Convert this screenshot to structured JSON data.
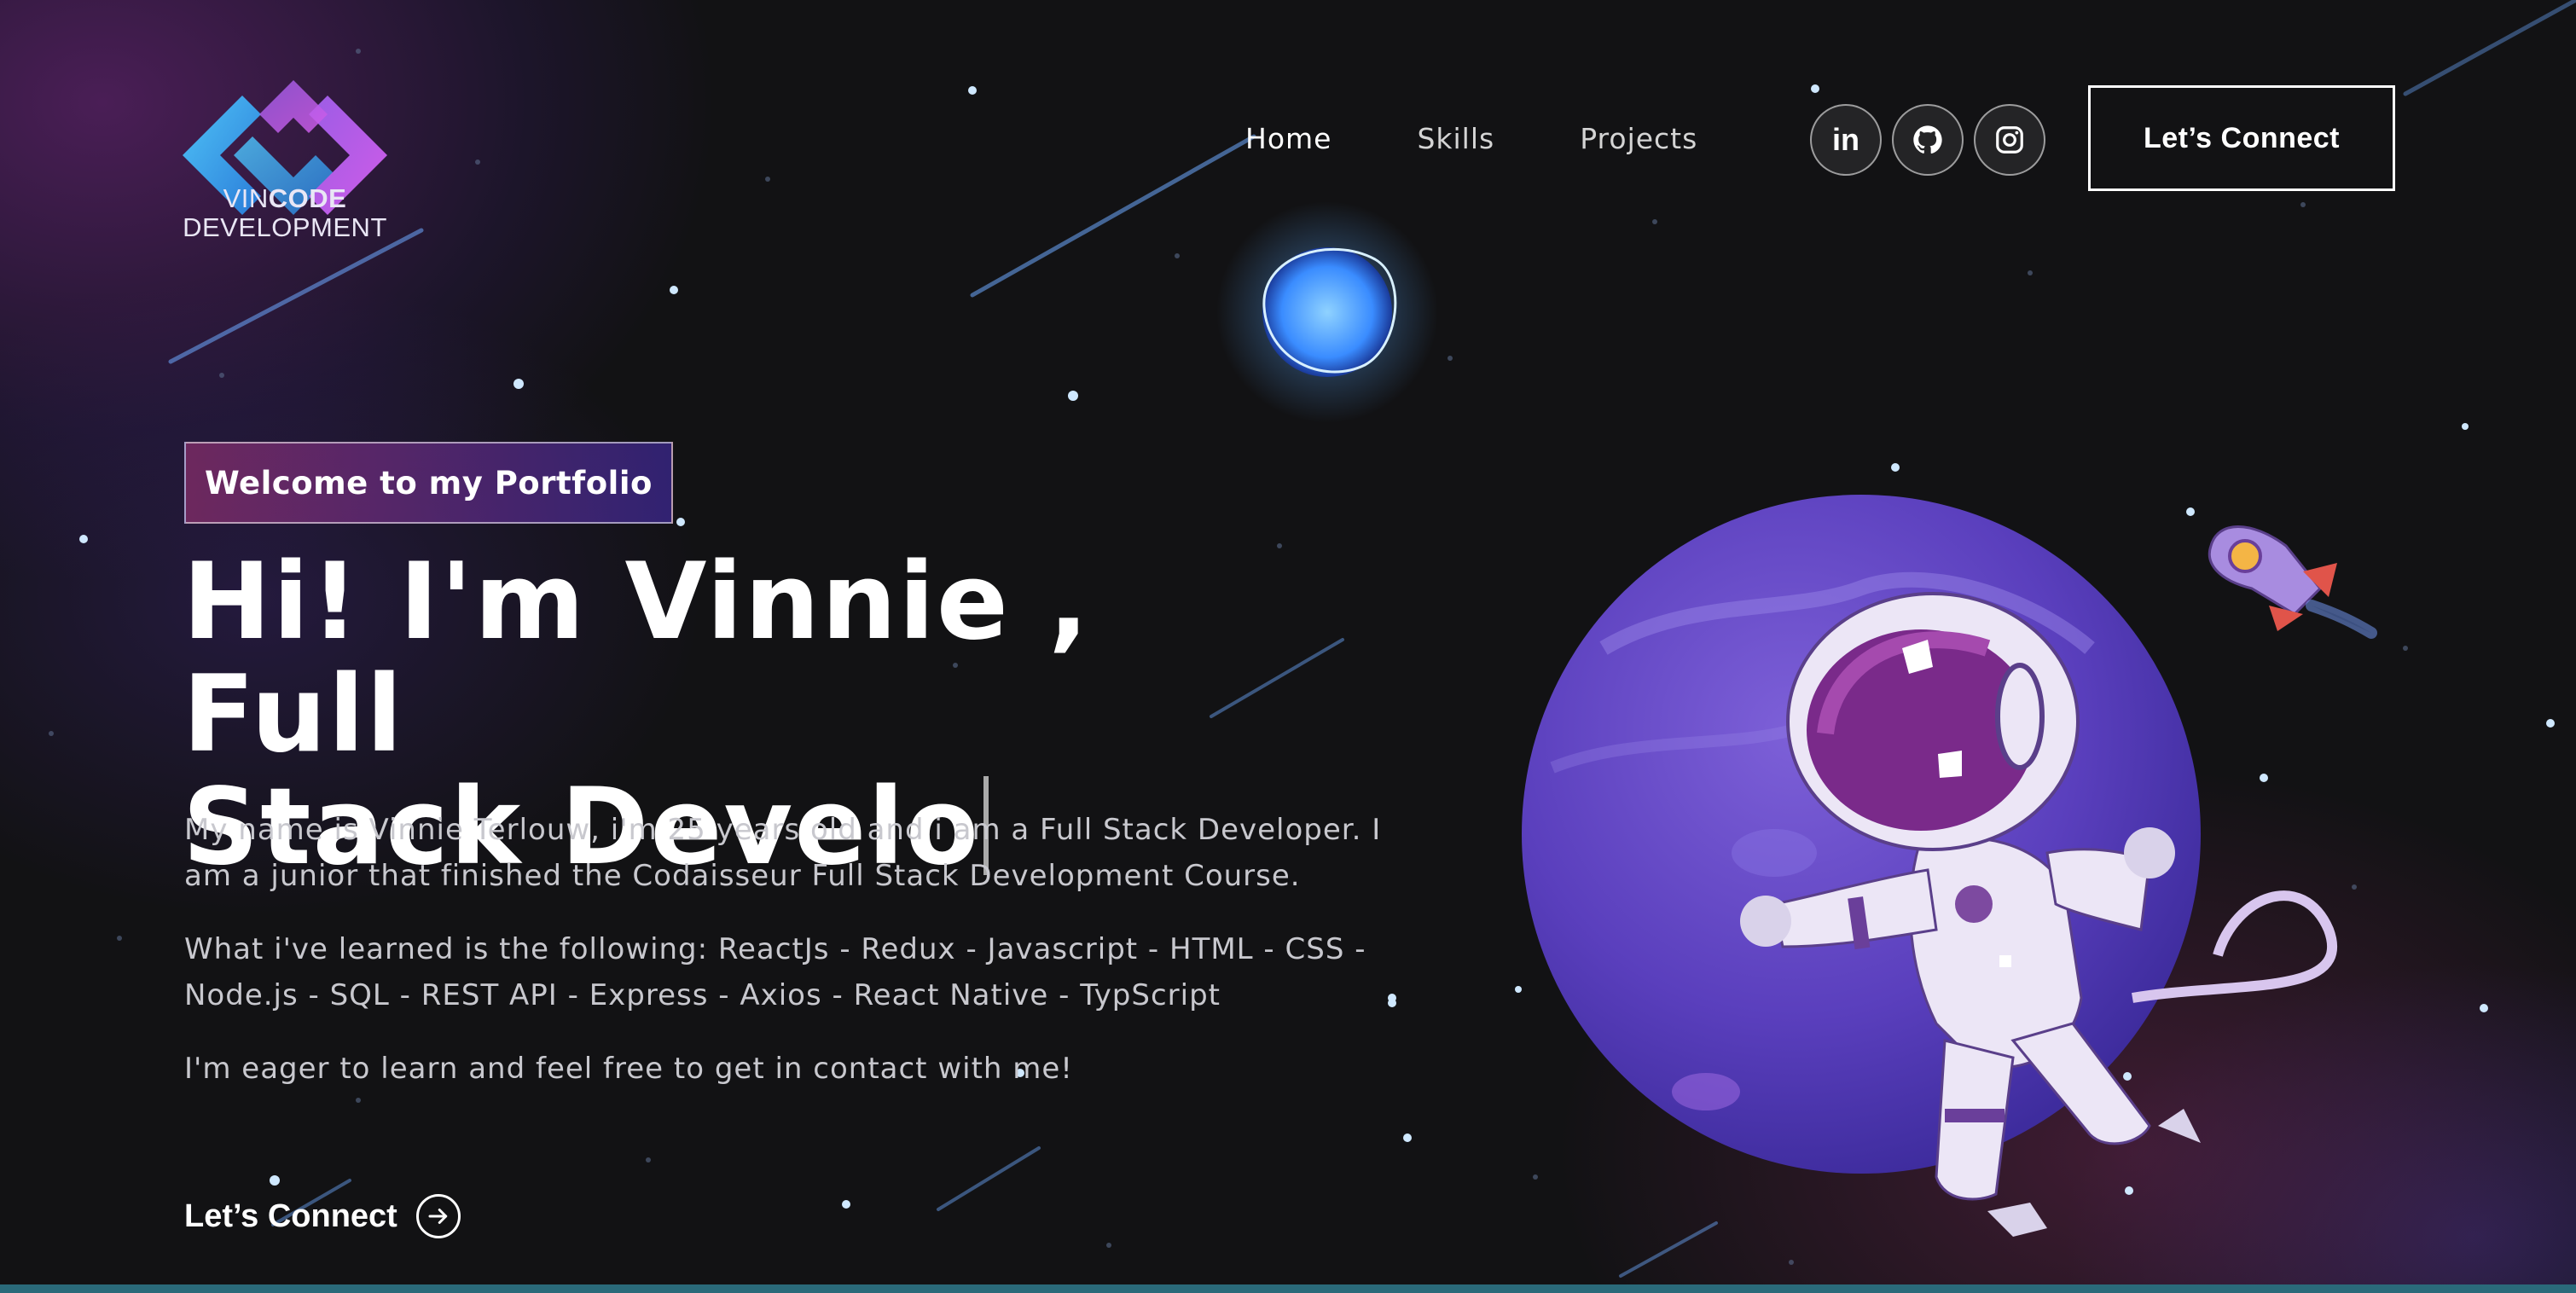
{
  "brand": {
    "logo_line1_a": "VIN",
    "logo_line1_b": "CODE",
    "logo_line2": "DEVELOPMENT"
  },
  "nav": {
    "links": [
      "Home",
      "Skills",
      "Projects"
    ],
    "socials": [
      "in",
      "github",
      "instagram"
    ],
    "cta": "Let’s Connect"
  },
  "hero": {
    "tagline": "Welcome to my Portfolio",
    "title_line1": "Hi! I'm Vinnie , Full",
    "title_line2": "Stack Develo",
    "p1": "My name is Vinnie Terlouw, i'm 25 years old and i am a Full Stack Developer. I am a junior that finished the Codaisseur Full Stack Development Course.",
    "p2": "What i've learned is the following: ReactJs - Redux - Javascript - HTML - CSS - Node.js - SQL - REST API - Express - Axios - React Native - TypScript",
    "p3": "I'm eager to learn and feel free to get in contact with me!",
    "cta": "Let’s Connect"
  },
  "colors": {
    "background": "#121214",
    "accent_pink": "#aa367c",
    "accent_purple": "#4a2fbd",
    "text": "#ffffff"
  },
  "icons": [
    "logo-mark",
    "linkedin-icon",
    "github-icon",
    "instagram-icon",
    "arrow-right-circle-icon"
  ],
  "illustration": [
    "astronaut",
    "purple-planet",
    "blue-moon",
    "rocket",
    "stars",
    "shooting-stars"
  ]
}
